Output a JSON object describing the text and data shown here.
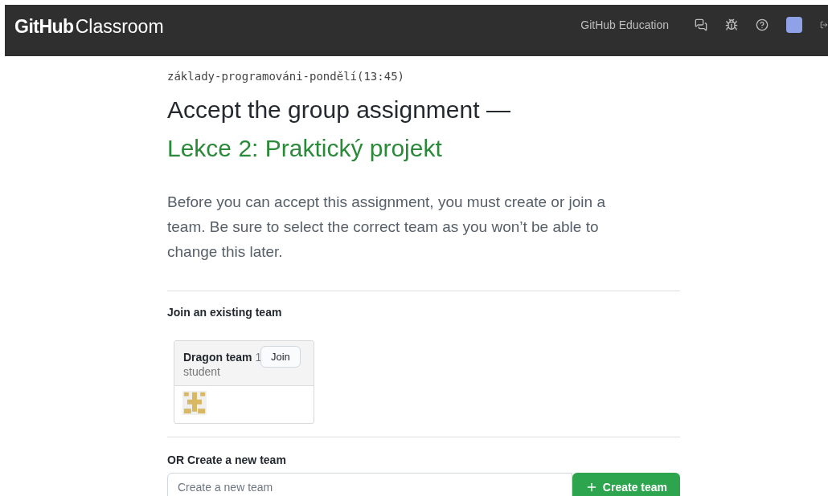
{
  "header": {
    "logo_bold": "GitHub",
    "logo_light": "Classroom",
    "link": "GitHub Education"
  },
  "classroom": "základy-programováni-pondělí(13:45)",
  "title": "Accept the group assignment —",
  "assignment": "Lekce 2: Praktický projekt",
  "intro": "Before you can accept this assignment, you must create or join a team. Be sure to select the correct team as you won’t be able to change this later.",
  "join_heading": "Join an existing team",
  "teams": [
    {
      "label": "**Dragon team** 1 student",
      "button": "Join"
    }
  ],
  "create_heading": "OR Create a new team",
  "create_field": {
    "placeholder": "Create a new team"
  },
  "create_button": "Create team"
}
